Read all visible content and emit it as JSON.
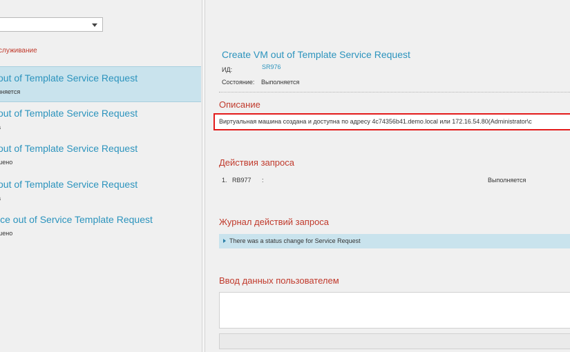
{
  "left": {
    "filter_value": "",
    "category": "служивание",
    "requests": [
      {
        "title": "out of Template Service Request",
        "status": "лняется",
        "selected": true
      },
      {
        "title": "out of Template Service Request",
        "status": "а",
        "selected": false
      },
      {
        "title": "out of Template Service Request",
        "status": "шено",
        "selected": false
      },
      {
        "title": "out of Template Service Request",
        "status": "а",
        "selected": false
      },
      {
        "title": "ice out of Service Template Request",
        "status": "шено",
        "selected": false
      }
    ]
  },
  "detail": {
    "title": "Create VM out of Template Service Request",
    "id_label": "ИД:",
    "id_value": "SR976",
    "state_label": "Состояние:",
    "state_value": "Выполняется",
    "description_heading": "Описание",
    "description_text": "Виртуальная машина создана и доступна по адресу 4c74356b41.demo.local или 172.16.54.80(Administrator\\c",
    "actions_heading": "Действия запроса",
    "actions": [
      {
        "num": "1.",
        "ref": "RB977",
        "colon": ":",
        "status": "Выполняется"
      }
    ],
    "log_heading": "Журнал действий запроса",
    "log_entry": "There was a status change for Service Request",
    "user_input_heading": "Ввод данных пользователем"
  },
  "colors": {
    "accent_blue": "#2b93bd",
    "heading_red": "#c0392b",
    "highlight_box": "#e31a1a",
    "selected_bg": "#c9e3ed"
  }
}
